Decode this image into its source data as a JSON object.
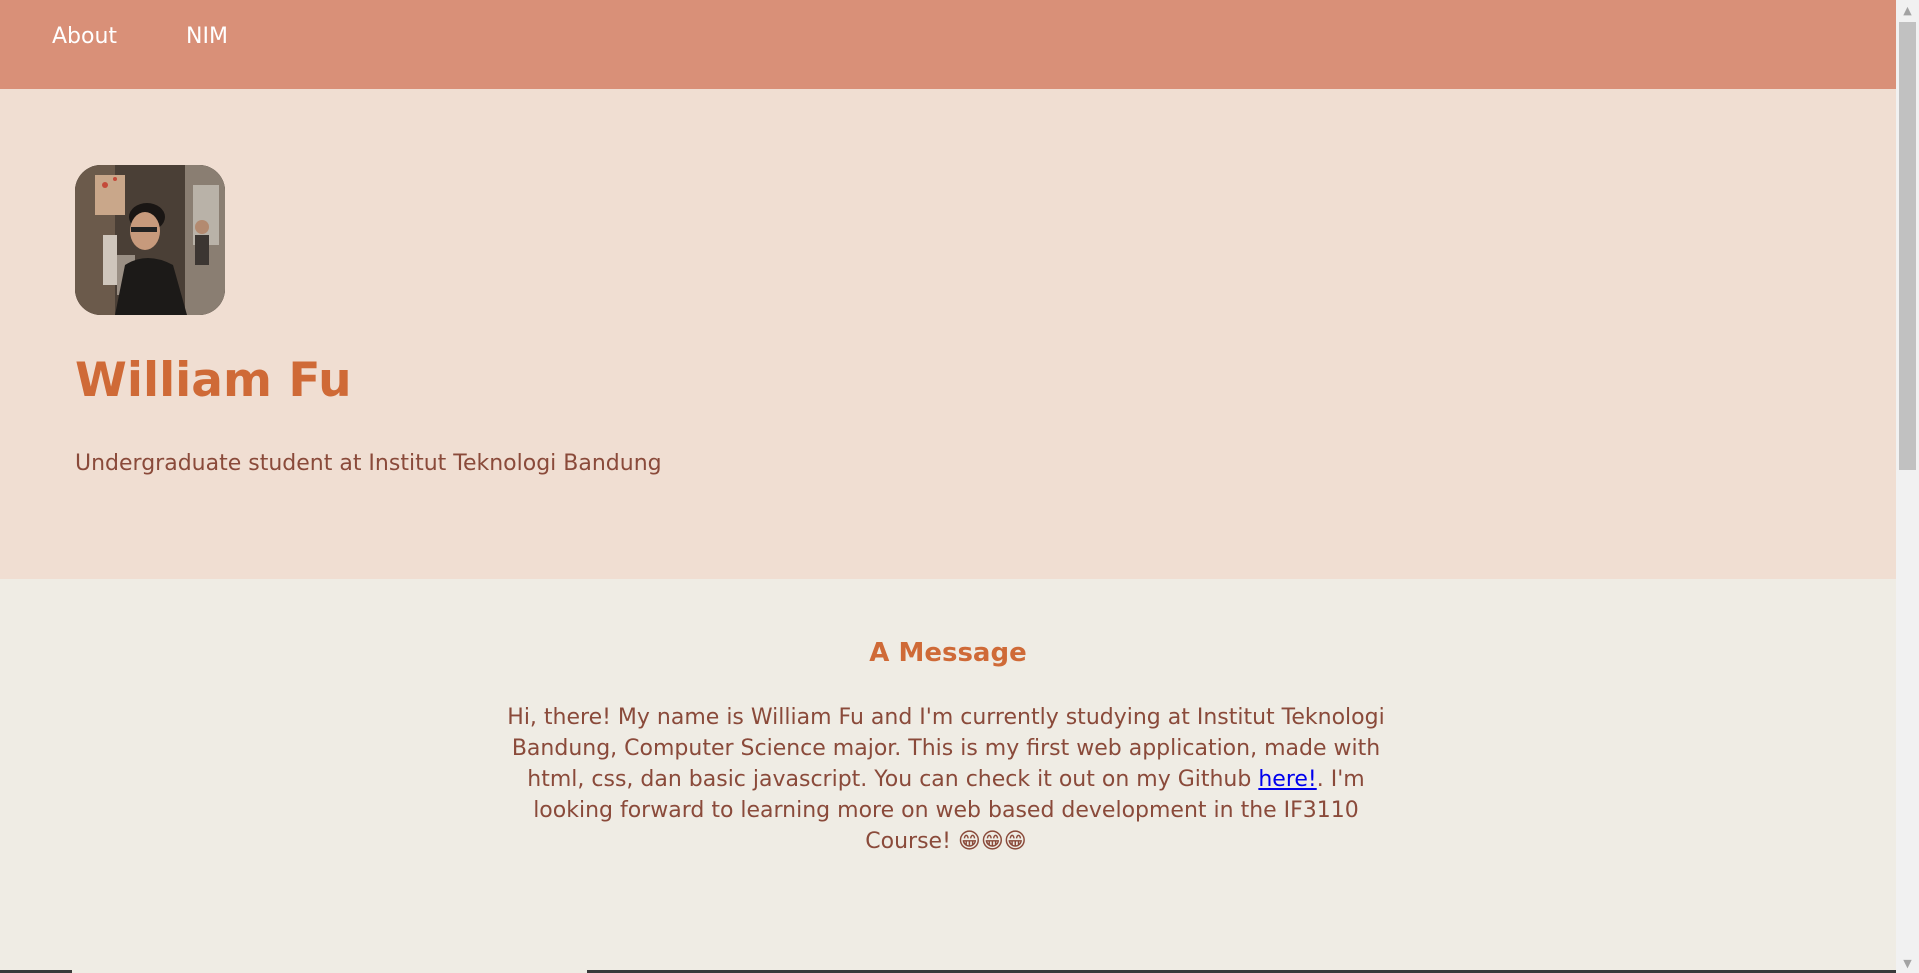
{
  "nav": {
    "items": [
      {
        "label": "About"
      },
      {
        "label": "NIM"
      }
    ]
  },
  "hero": {
    "avatar_alt": "profile photo",
    "name": "William Fu",
    "subtitle": "Undergraduate student at Institut Teknologi Bandung"
  },
  "message": {
    "title": "A Message",
    "body_before_link": "Hi, there! My name is William Fu and I'm currently studying at Institut Teknologi Bandung, Computer Science major. This is my first web application, made with html, css, dan basic javascript. You can check it out on my Github ",
    "link_text": "here!",
    "body_after_link": ". I'm looking forward to learning more on web based development in the IF3110 Course! ",
    "emoji": "😁😁😁"
  },
  "colors": {
    "nav_bg": "#d99078",
    "hero_bg": "#f0ded2",
    "page_bg": "#efece4",
    "accent": "#cf6a37",
    "text": "#8a4a3a",
    "link": "#0000ee"
  }
}
